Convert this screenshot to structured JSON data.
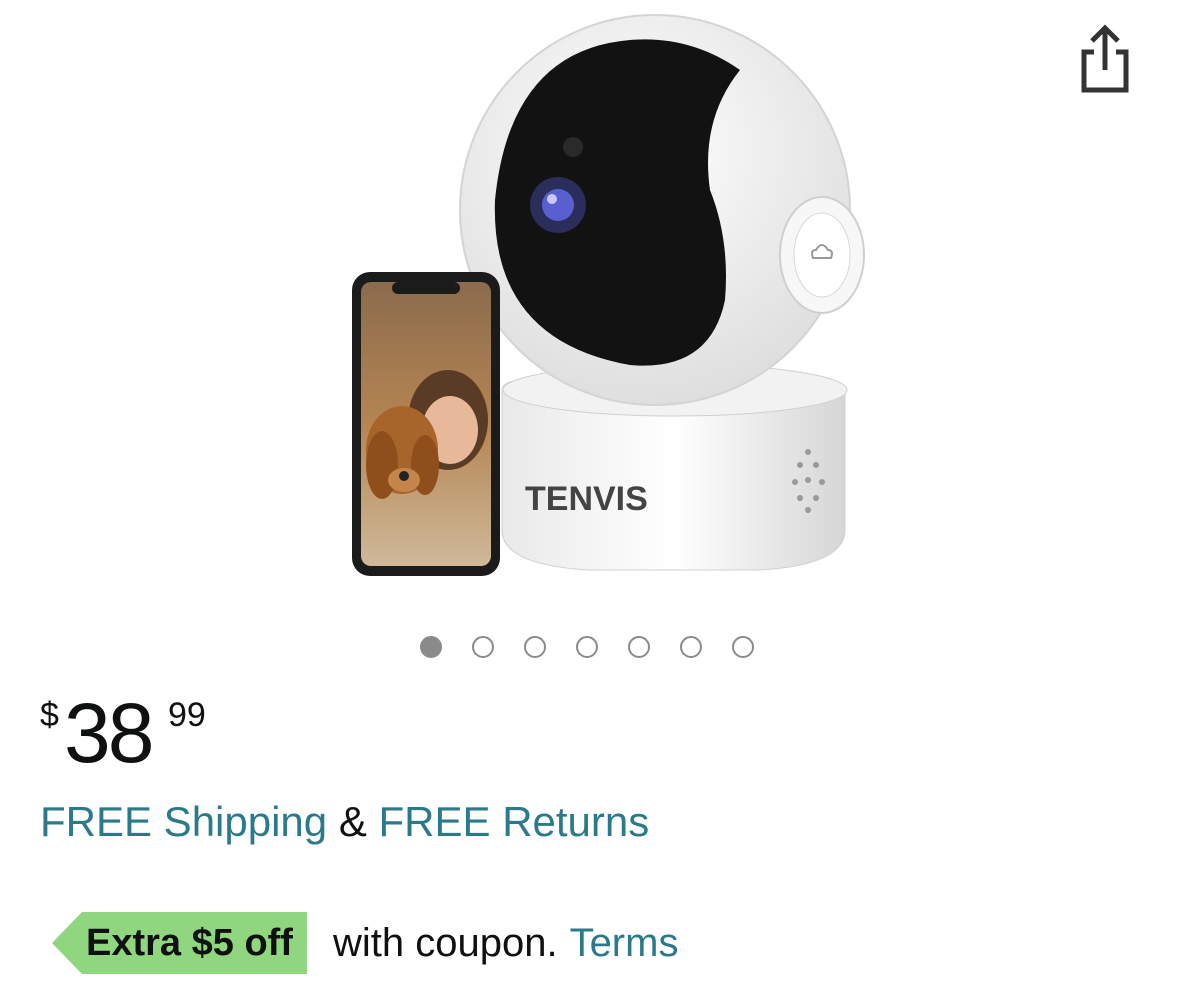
{
  "header": {
    "share_icon": "share-icon"
  },
  "product": {
    "brand_on_device": "TENVIS",
    "image_count": 7,
    "active_image_index": 0
  },
  "price": {
    "symbol": "$",
    "whole": "38",
    "fraction": "99"
  },
  "shipping": {
    "free_shipping": "FREE Shipping",
    "amp": "&",
    "free_returns": "FREE Returns"
  },
  "coupon": {
    "badge_text": "Extra $5 off",
    "text": "with coupon.",
    "terms_label": "Terms",
    "badge_color": "#8fd67e"
  },
  "colors": {
    "link": "#2a7a8c",
    "text": "#0f1111",
    "dot": "#8a8a8a"
  }
}
